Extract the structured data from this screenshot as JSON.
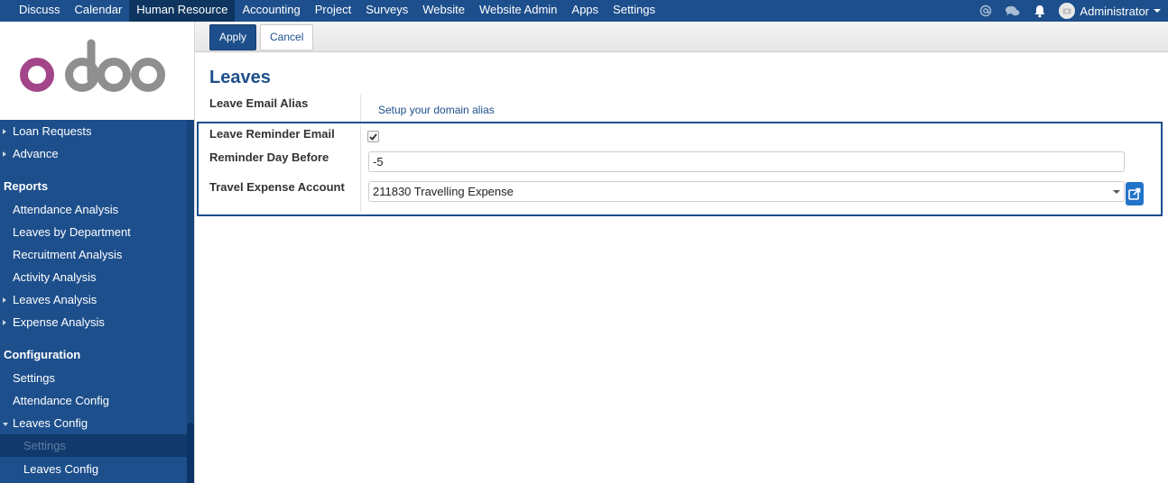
{
  "topbar": {
    "menu": [
      "Discuss",
      "Calendar",
      "Human Resource",
      "Accounting",
      "Project",
      "Surveys",
      "Website",
      "Website Admin",
      "Apps",
      "Settings"
    ],
    "active": "Human Resource",
    "user": "Administrator",
    "icons": [
      "at-icon",
      "chat-icon",
      "bell-icon"
    ]
  },
  "logo": "odoo",
  "sidebar": {
    "top_items": [
      "Loan Requests",
      "Advance"
    ],
    "reports_heading": "Reports",
    "reports": [
      "Attendance Analysis",
      "Leaves by Department",
      "Recruitment Analysis",
      "Activity Analysis",
      "Leaves Analysis",
      "Expense Analysis"
    ],
    "config_heading": "Configuration",
    "config": [
      "Settings",
      "Attendance Config",
      "Leaves Config"
    ],
    "config_sub": [
      "Settings",
      "Leaves Config"
    ]
  },
  "toolbar": {
    "apply": "Apply",
    "cancel": "Cancel"
  },
  "form": {
    "title": "Leaves",
    "alias_label": "Leave Email Alias",
    "alias_link": "Setup your domain alias",
    "reminder_label": "Leave Reminder Email",
    "reminder_checked": true,
    "day_label": "Reminder Day Before",
    "day_value": "-5",
    "account_label": "Travel Expense Account",
    "account_value": "211830 Travelling Expense"
  },
  "colors": {
    "brand": "#1d4f8c",
    "logo_purple": "#a24689",
    "logo_grey": "#8f8f8f"
  }
}
